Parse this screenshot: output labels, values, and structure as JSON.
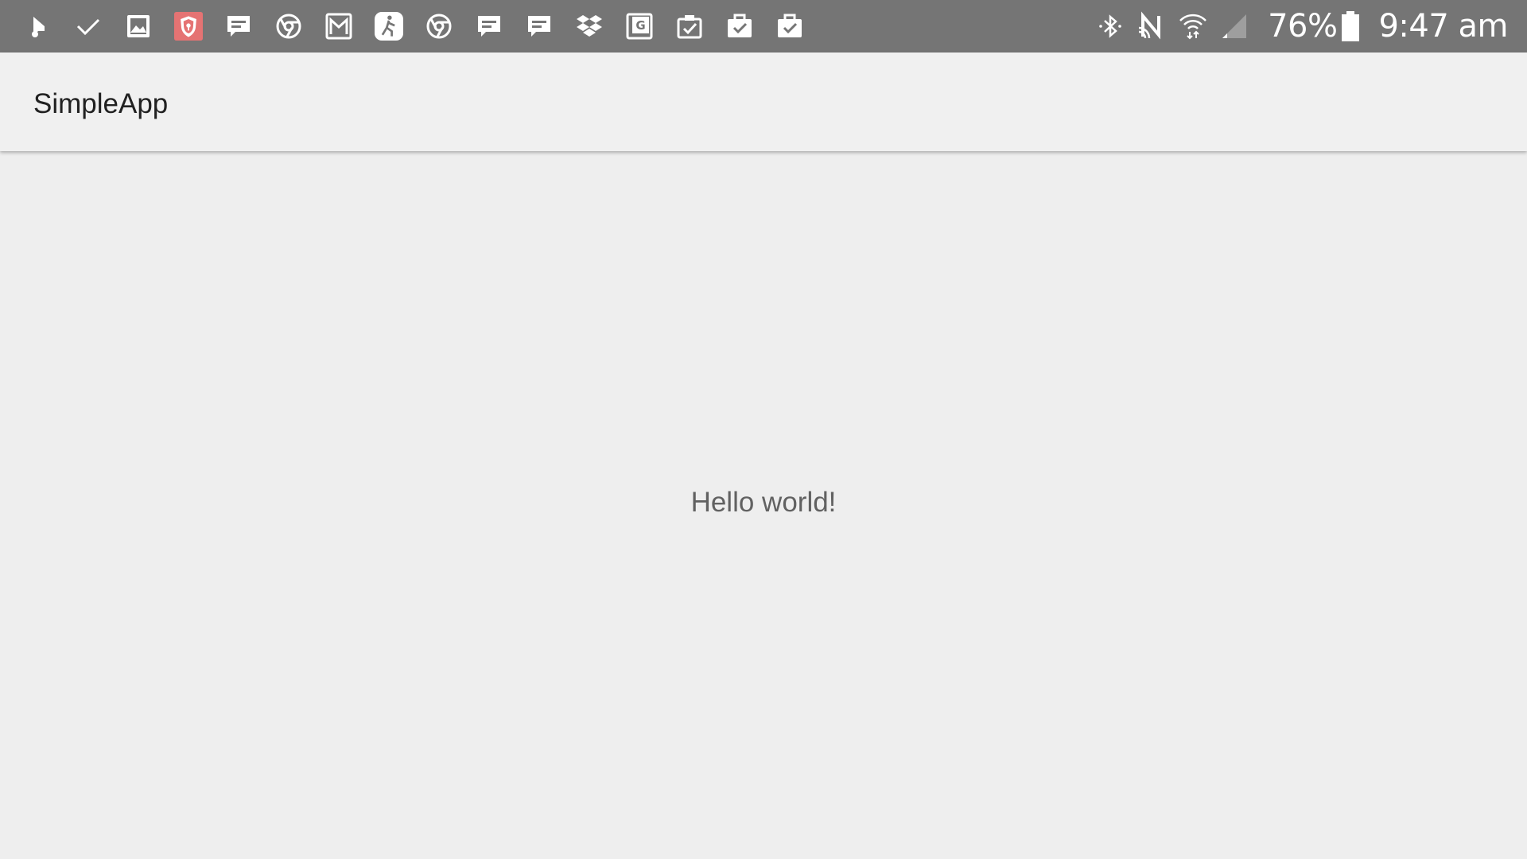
{
  "status_bar": {
    "notification_icons": [
      "location-pin-icon",
      "checkmark-icon",
      "image-icon",
      "shield-app-icon",
      "message-icon",
      "chrome-icon",
      "gmail-icon",
      "fitness-icon",
      "chrome-icon",
      "message-icon",
      "message-icon",
      "dropbox-icon",
      "google-photos-icon",
      "clipboard-check-icon",
      "briefcase-check-icon",
      "briefcase-check-icon"
    ],
    "system_icons": [
      "bluetooth-icon",
      "nfc-icon",
      "wifi-icon",
      "cell-signal-icon"
    ],
    "battery_percent": "76%",
    "time": "9:47 am",
    "background_color": "#757575",
    "accent_color": "#e57373"
  },
  "app_bar": {
    "title": "SimpleApp"
  },
  "main": {
    "message": "Hello world!"
  }
}
